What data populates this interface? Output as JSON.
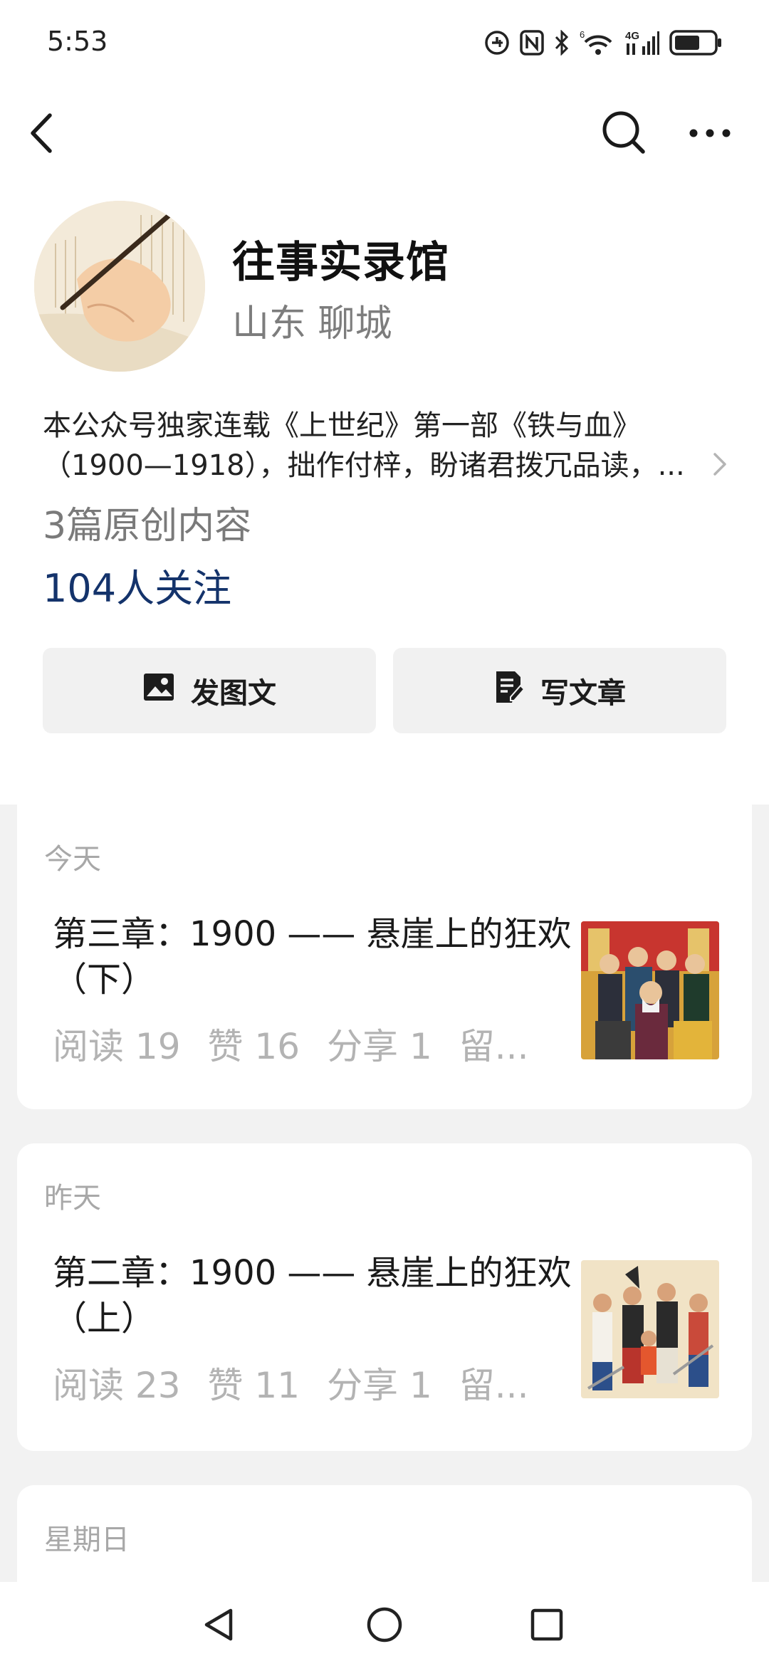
{
  "status_bar": {
    "time": "5:53",
    "icons": [
      "alarm-icon",
      "nfc-icon",
      "bluetooth-icon",
      "wifi-6-icon",
      "4g-signal-icon",
      "battery-icon"
    ],
    "wifi_badge": "6",
    "network_label": "4G"
  },
  "nav": {
    "icons": [
      "back-icon",
      "search-icon",
      "more-icon"
    ]
  },
  "profile": {
    "name": "往事实录馆",
    "location": "山东 聊城",
    "bio_line1": "本公众号独家连载《上世纪》第一部《铁与血》",
    "bio_line2": "（1900—1918），拙作付梓，盼诸君拨冗品读，...",
    "original_count": "3篇原创内容",
    "followers": "104人关注"
  },
  "actions": {
    "image_post_label": "发图文",
    "write_article_label": "写文章"
  },
  "posts": [
    {
      "date": "今天",
      "title": "第三章：1900 —— 悬崖上的狂欢（下）",
      "stats": {
        "read": "阅读 19",
        "like": "赞 16",
        "share": "分享 1",
        "comment": "留..."
      }
    },
    {
      "date": "昨天",
      "title": "第二章：1900 —— 悬崖上的狂欢（上）",
      "stats": {
        "read": "阅读 23",
        "like": "赞 11",
        "share": "分享 1",
        "comment": "留..."
      }
    },
    {
      "date": "星期日"
    }
  ],
  "colors": {
    "followers": "#14336b",
    "muted": "#7d7d7d",
    "stats": "#b3b3b3",
    "button_bg": "#f1f1f1",
    "page_bg": "#f2f2f2"
  }
}
